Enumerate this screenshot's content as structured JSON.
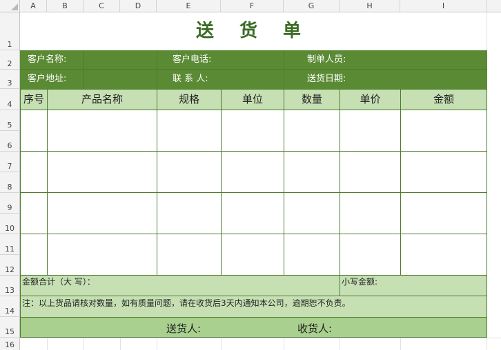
{
  "sheet": {
    "columns": [
      "A",
      "B",
      "C",
      "D",
      "E",
      "F",
      "G",
      "H",
      "I"
    ],
    "rows": [
      "1",
      "2",
      "3",
      "4",
      "5",
      "6",
      "7",
      "8",
      "9",
      "10",
      "11",
      "12",
      "13",
      "14",
      "15",
      "16"
    ]
  },
  "form": {
    "title": "送 货 单",
    "info_row1": {
      "customer_name": "客户名称:",
      "customer_phone": "客户电话:",
      "creator": "制单人员:"
    },
    "info_row2": {
      "customer_address": "客户地址:",
      "contact": "联 系 人:",
      "delivery_date": "送货日期:"
    },
    "table_headers": [
      "序号",
      "产品名称",
      "规格",
      "单位",
      "数量",
      "单价",
      "金额"
    ],
    "total_upper": "金额合计（大 写）：",
    "total_lower": "小写金额:",
    "note": "注：以上货品请核对数量，如有质量问题，请在收货后3天内通知本公司，逾期恕不负责。",
    "sender": "送货人:",
    "receiver": "收货人:"
  },
  "colors": {
    "dark_green": "#5b8a34",
    "light_green": "#c6e0b4",
    "mid_green": "#a9d08e",
    "title_green": "#3a6b24"
  }
}
